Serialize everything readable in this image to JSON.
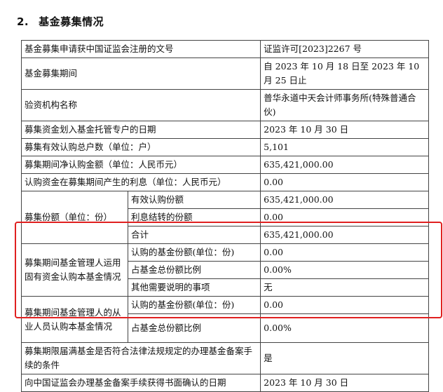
{
  "section": {
    "number": "2.",
    "title": "基金募集情况"
  },
  "rows": {
    "r1_label": "基金募集申请获中国证监会注册的文号",
    "r1_value": "证监许可[2023]2267 号",
    "r2_label": "基金募集期间",
    "r2_value": "自 2023 年 10 月 18 日至 2023 年 10 月 25 日止",
    "r3_label": "验资机构名称",
    "r3_value": "普华永道中天会计师事务所(特殊普通合伙)",
    "r4_label": "募集资金划入基金托管专户的日期",
    "r4_value": "2023 年 10 月 30 日",
    "r5_label": "募集有效认购总户数（单位：户）",
    "r5_value": "5,101",
    "r6_label": "募集期间净认购金额（单位：人民币元）",
    "r6_value": "635,421,000.00",
    "r7_label": "认购资金在募集期间产生的利息（单位：人民币元）",
    "r7_value": "0.00",
    "shares_label": "募集份额（单位：份）",
    "shares_valid_label": "有效认购份额",
    "shares_valid_value": "635,421,000.00",
    "shares_interest_label": "利息结转的份额",
    "shares_interest_value": "0.00",
    "shares_total_label": "合计",
    "shares_total_value": "635,421,000.00",
    "mgr_own_label": "募集期间基金管理人运用固有资金认购本基金情况",
    "mgr_own_sub1_label": "认购的基金份额(单位：份)",
    "mgr_own_sub1_value": "0.00",
    "mgr_own_sub2_label": "占基金总份额比例",
    "mgr_own_sub2_value": "0.00%",
    "mgr_own_sub3_label": "其他需要说明的事项",
    "mgr_own_sub3_value": "无",
    "staff_label": "募集期间基金管理人的从业人员认购本基金情况",
    "staff_sub1_label": "认购的基金份额(单位：份)",
    "staff_sub1_value": "0.00",
    "staff_sub2_label": "占基金总份额比例",
    "staff_sub2_value": "0.00%",
    "r_cond_label": "募集期限届满基金是否符合法律法规规定的办理基金备案手续的条件",
    "r_cond_value": "是",
    "r_conf_label": "向中国证监会办理基金备案手续获得书面确认的日期",
    "r_conf_value": "2023 年 10 月 30 日"
  },
  "colors": {
    "highlight": "#e02020"
  }
}
